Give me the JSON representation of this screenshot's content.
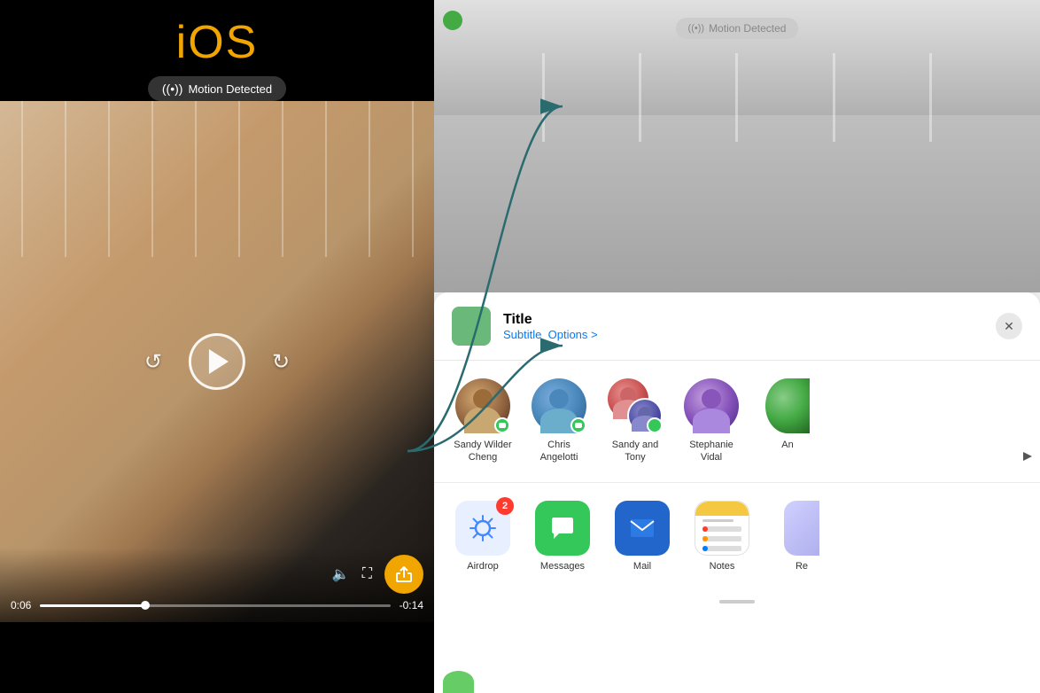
{
  "left": {
    "ios_label": "iOS",
    "motion_badge": "Motion Detected",
    "play_time": "0:06",
    "remaining_time": "-0:14"
  },
  "right": {
    "preview_motion_badge": "Motion Detected",
    "share_title": "Title",
    "share_subtitle": "Subtitle",
    "share_options": "Options >",
    "close_label": "✕",
    "contacts": [
      {
        "name": "Sandy Wilder\nCheng",
        "type": "sandy1"
      },
      {
        "name": "Chris\nAngelotti",
        "type": "chris"
      },
      {
        "name": "Sandy and\nTony",
        "type": "sandytony"
      },
      {
        "name": "Stephanie\nVidal",
        "type": "stephanie"
      },
      {
        "name": "An",
        "type": "partial"
      }
    ],
    "apps": [
      {
        "name": "Airdrop",
        "type": "airdrop",
        "badge": "2"
      },
      {
        "name": "Messages",
        "type": "messages"
      },
      {
        "name": "Mail",
        "type": "mail"
      },
      {
        "name": "Notes",
        "type": "notes"
      },
      {
        "name": "Re",
        "type": "partial"
      }
    ]
  }
}
